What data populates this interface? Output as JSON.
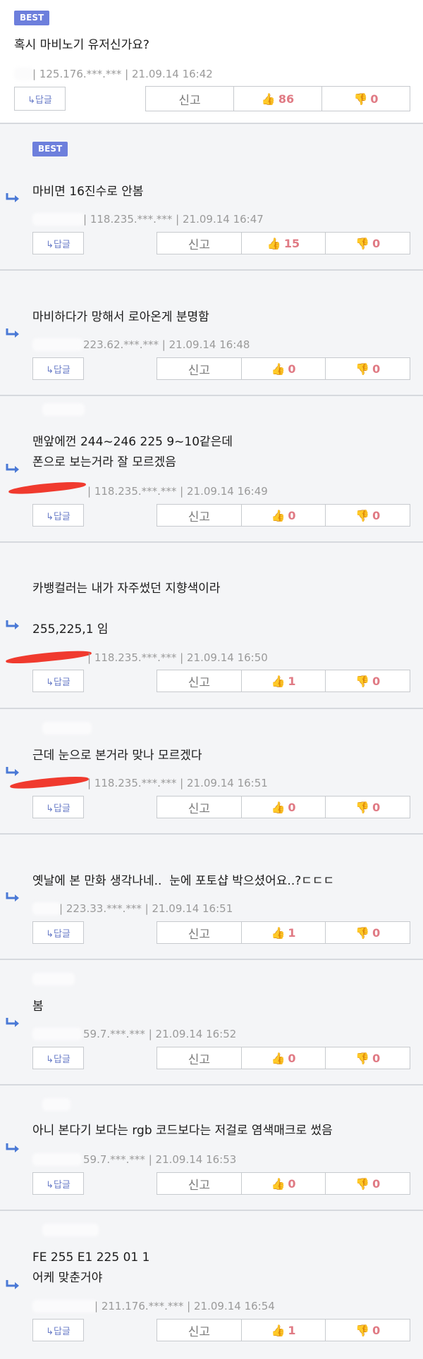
{
  "labels": {
    "best": "BEST",
    "reply_button": "↳답글",
    "report_button": "신고"
  },
  "comments": [
    {
      "lines": [
        "혹시 마비노기 유저신가요?"
      ],
      "ip": "125.176.***.***",
      "date": "21.09.14 16:42",
      "likes": "86",
      "dislikes": "0",
      "best": true
    },
    {
      "lines": [
        "마비면 16진수로 안봄"
      ],
      "ip": "118.235.***.***",
      "date": "21.09.14 16:47",
      "likes": "15",
      "dislikes": "0",
      "best": true
    },
    {
      "lines": [
        "마비하다가 망해서 로아온게 분명함"
      ],
      "ip": "223.62.***.***",
      "date": "21.09.14 16:48",
      "likes": "0",
      "dislikes": "0"
    },
    {
      "lines": [
        "맨앞에껀 244~246 225 9~10같은데",
        "폰으로 보는거라 잘 모르겠음"
      ],
      "ip": "118.235.***.***",
      "date": "21.09.14 16:49",
      "likes": "0",
      "dislikes": "0"
    },
    {
      "lines": [
        "카뱅컬러는 내가 자주썼던 지향색이라",
        "",
        "255,225,1 임"
      ],
      "ip": "118.235.***.***",
      "date": "21.09.14 16:50",
      "likes": "1",
      "dislikes": "0"
    },
    {
      "lines": [
        "근데 눈으로 본거라 맞나 모르겠다"
      ],
      "ip": "118.235.***.***",
      "date": "21.09.14 16:51",
      "likes": "0",
      "dislikes": "0"
    },
    {
      "lines": [
        "옛날에 본 만화 생각나네..  눈에 포토샵 박으셨어요..?ㄷㄷㄷ"
      ],
      "ip": "223.33.***.***",
      "date": "21.09.14 16:51",
      "likes": "1",
      "dislikes": "0"
    },
    {
      "lines": [
        "봄"
      ],
      "ip": "59.7.***.***",
      "date": "21.09.14 16:52",
      "likes": "0",
      "dislikes": "0"
    },
    {
      "lines": [
        "아니 본다기 보다는 rgb 코드보다는 저걸로 염색매크로 썼음"
      ],
      "ip": "59.7.***.***",
      "date": "21.09.14 16:53",
      "likes": "0",
      "dislikes": "0"
    },
    {
      "lines": [
        "FE 255 E1 225 01 1",
        "어케 맞춘거야"
      ],
      "ip": "211.176.***.***",
      "date": "21.09.14 16:54",
      "likes": "1",
      "dislikes": "0"
    }
  ]
}
